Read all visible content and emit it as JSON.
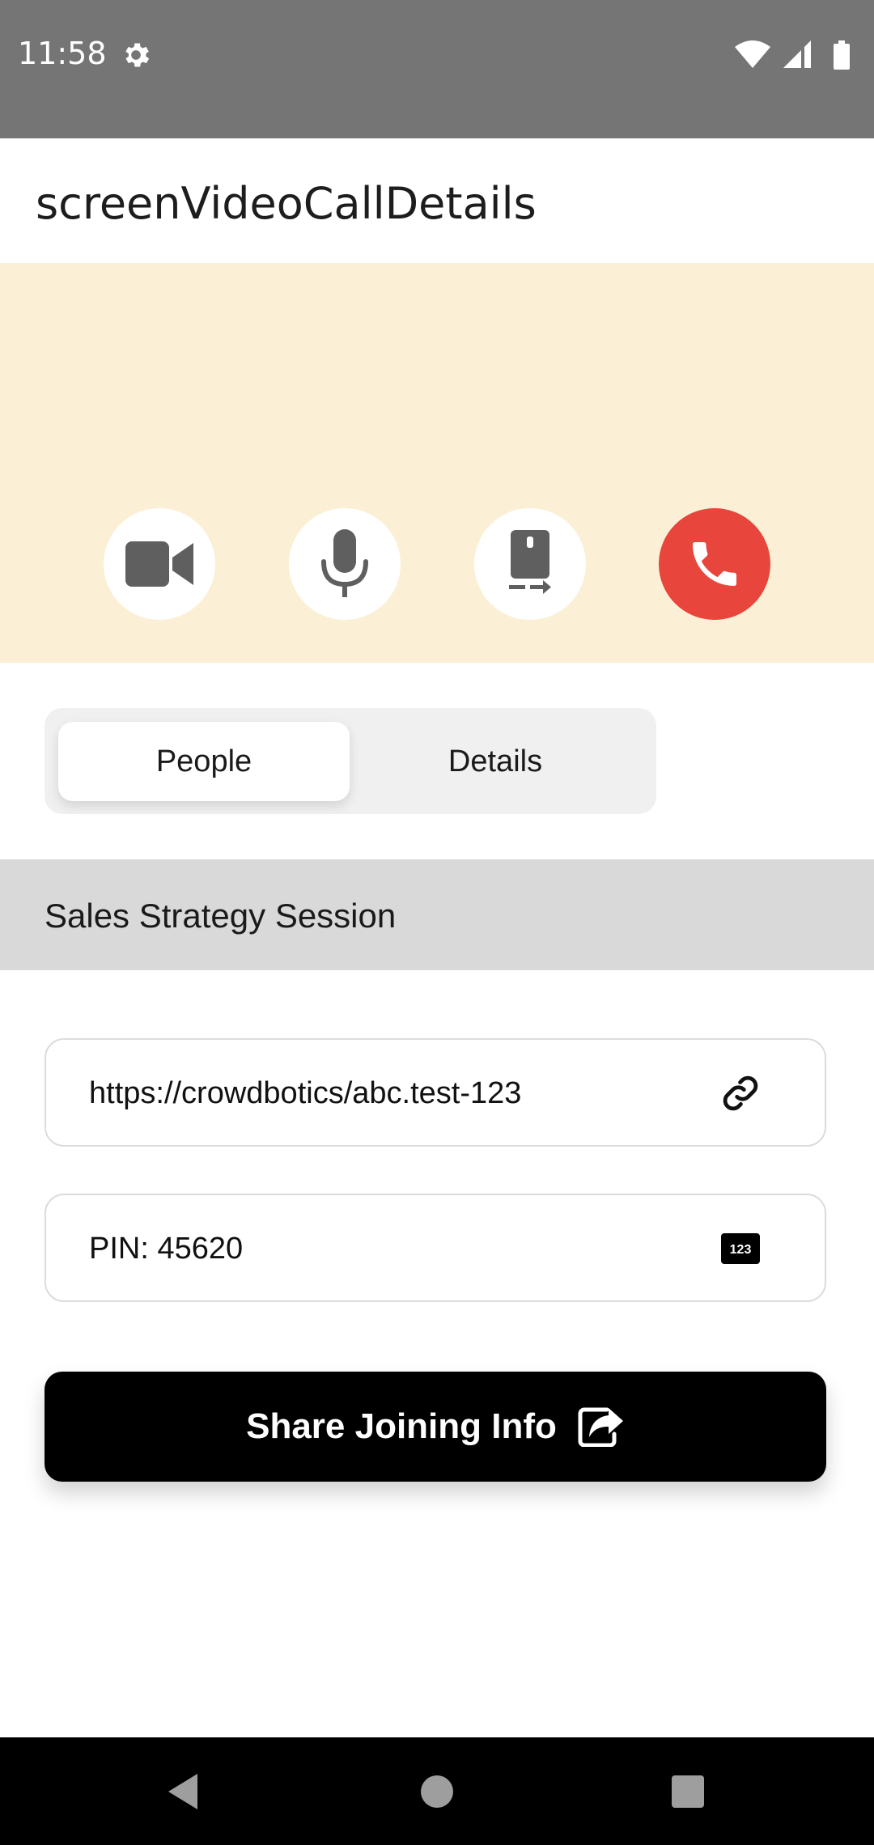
{
  "status_bar": {
    "time": "11:58",
    "icons": [
      "gear-icon",
      "wifi-icon",
      "signal-icon",
      "battery-icon"
    ]
  },
  "app_bar": {
    "title": "screenVideoCallDetails"
  },
  "call_controls": {
    "buttons": [
      "video-camera-icon",
      "microphone-icon",
      "switch-camera-icon",
      "end-call-icon"
    ],
    "end_call_color": "#e8453c",
    "video_area_color": "#fbf0d6"
  },
  "tabs": {
    "items": [
      {
        "label": "People",
        "active": true
      },
      {
        "label": "Details",
        "active": false
      }
    ]
  },
  "meeting": {
    "title": "Sales Strategy Session",
    "link": "https://crowdbotics/abc.test-123",
    "pin": "PIN: 45620",
    "pin_icon_text": "123"
  },
  "share_button": {
    "label": "Share Joining Info"
  },
  "nav": {
    "icons": [
      "back-icon",
      "home-icon",
      "recents-icon"
    ]
  }
}
